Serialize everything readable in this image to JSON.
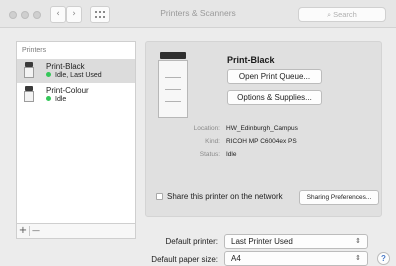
{
  "window": {
    "title": "Printers & Scanners",
    "nav_back": "‹",
    "nav_forward": "›",
    "grid_icon": "grid-icon",
    "search_placeholder": "Search"
  },
  "printers": {
    "header": "Printers",
    "items": [
      {
        "name": "Print-Black",
        "status": "Idle, Last Used",
        "selected": true
      },
      {
        "name": "Print-Colour",
        "status": "Idle",
        "selected": false
      }
    ],
    "add_label": "+",
    "remove_label": "—"
  },
  "detail": {
    "printer_name": "Print-Black",
    "open_queue_label": "Open Print Queue...",
    "options_label": "Options & Supplies...",
    "info": [
      {
        "label": "Location:",
        "value": "HW_Edinburgh_Campus"
      },
      {
        "label": "Kind:",
        "value": "RICOH MP C6004ex PS"
      },
      {
        "label": "Status:",
        "value": "Idle"
      }
    ],
    "share_label": "Share this printer on the network",
    "share_checked": false,
    "sharing_prefs_label": "Sharing Preferences..."
  },
  "defaults": {
    "printer_label": "Default printer:",
    "printer_value": "Last Printer Used",
    "paper_label": "Default paper size:",
    "paper_value": "A4"
  },
  "help_label": "?",
  "colors": {
    "status_green": "#34c759",
    "selection": "#dcdcdc"
  }
}
